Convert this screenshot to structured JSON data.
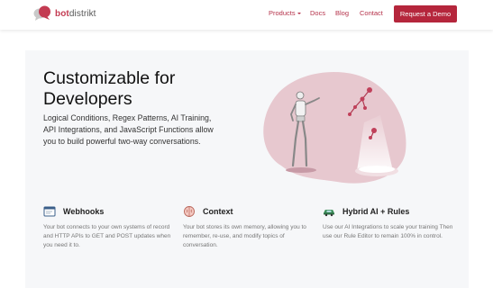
{
  "brand": {
    "name_bold": "bot",
    "name_rest": "distrikt",
    "logo_icon": "speech-bubbles-icon"
  },
  "nav": {
    "products": "Products",
    "docs": "Docs",
    "blog": "Blog",
    "contact": "Contact",
    "demo_button": "Request a Demo"
  },
  "hero": {
    "title_line1": "Customizable for",
    "title_line2": "Developers",
    "description": "Logical Conditions, Regex Patterns, AI Training, API Integrations, and JavaScript Functions allow you to build powerful two-way conversations.",
    "illustration_icon": "robot-platform-illustration"
  },
  "features": [
    {
      "icon": "browser-window-icon",
      "title": "Webhooks",
      "text": "Your bot connects to your own systems of record and HTTP APIs to GET and POST updates when you need it to."
    },
    {
      "icon": "brain-icon",
      "title": "Context",
      "text": "Your bot stores its own memory, allowing you to remember, re-use, and modify topics of conversation."
    },
    {
      "icon": "car-icon",
      "title": "Hybrid AI + Rules",
      "text": "Use our AI Integrations to scale your training Then use our Rule Editor to remain 100% in control."
    }
  ],
  "colors": {
    "brand": "#c33b52",
    "button": "#b5263c",
    "hero_bg": "#f6f7f9"
  }
}
